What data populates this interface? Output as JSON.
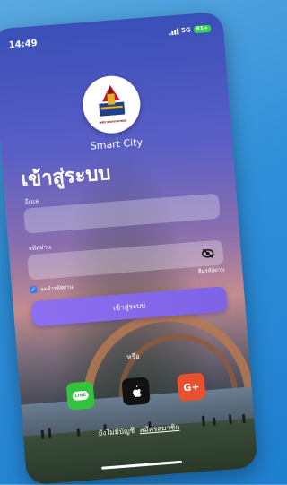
{
  "status_bar": {
    "time": "14:49",
    "network": "5G",
    "battery": "81+"
  },
  "app": {
    "name": "Smart City",
    "logo_text": "เทศบาลนครนครพนม"
  },
  "login": {
    "title": "เข้าสู่ระบบ",
    "email_label": "อีเมล",
    "email_value": "",
    "password_label": "รหัสผ่าน",
    "password_value": "",
    "forgot_password": "ลืมรหัสผ่าน",
    "remember_me": "จดจำรหัสผ่าน",
    "remember_checked": true,
    "submit_label": "เข้าสู่ระบบ",
    "or_label": "หรือ"
  },
  "social": {
    "line_label": "LINE",
    "google_label": "G+"
  },
  "signup": {
    "prompt": "ยังไม่มีบัญชี",
    "link": "สมัครสมาชิก"
  },
  "colors": {
    "accent": "#7e63e6",
    "line": "#33c33d",
    "google": "#e8502f",
    "page_bg": "#2f8fd8"
  }
}
